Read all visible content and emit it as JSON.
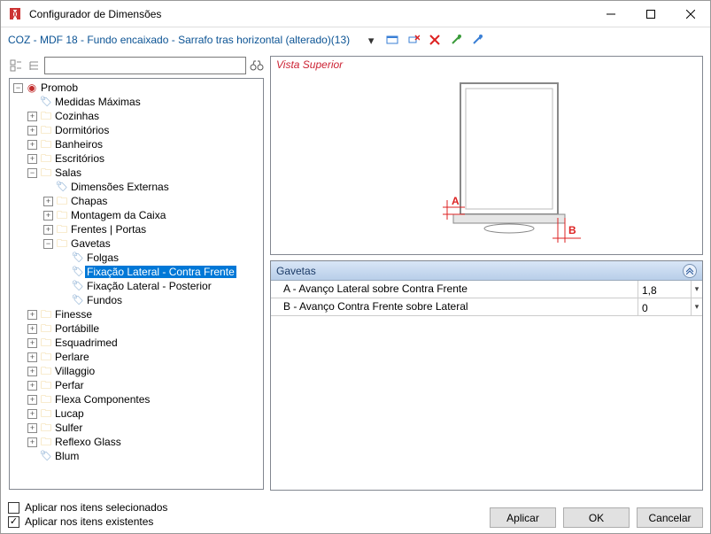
{
  "window": {
    "title": "Configurador de Dimensões"
  },
  "subtitle": "COZ - MDF 18 - Fundo encaixado - Sarrafo tras horizontal (alterado)(13)",
  "search": {
    "value": "",
    "placeholder": ""
  },
  "tree": {
    "root": "Promob",
    "n_medidas": "Medidas Máximas",
    "n_cozinhas": "Cozinhas",
    "n_dormitorios": "Dormitórios",
    "n_banheiros": "Banheiros",
    "n_escritorios": "Escritórios",
    "n_salas": "Salas",
    "n_dimext": "Dimensões Externas",
    "n_chapas": "Chapas",
    "n_montagem": "Montagem da Caixa",
    "n_frentes": "Frentes | Portas",
    "n_gavetas": "Gavetas",
    "n_folgas": "Folgas",
    "n_fixcf": "Fixação Lateral - Contra Frente",
    "n_fixpost": "Fixação Lateral - Posterior",
    "n_fundos": "Fundos",
    "n_finesse": "Finesse",
    "n_portabille": "Portábille",
    "n_esquadrimed": "Esquadrimed",
    "n_perlare": "Perlare",
    "n_villaggio": "Villaggio",
    "n_perfar": "Perfar",
    "n_flexa": "Flexa Componentes",
    "n_lucap": "Lucap",
    "n_sulfer": "Sulfer",
    "n_reflexo": "Reflexo Glass",
    "n_blum": "Blum"
  },
  "view": {
    "title": "Vista Superior",
    "label_a": "A",
    "label_b": "B"
  },
  "props": {
    "header": "Gavetas",
    "rows": [
      {
        "name": "A - Avanço Lateral sobre Contra Frente",
        "value": "1,8"
      },
      {
        "name": "B - Avanço Contra Frente sobre Lateral",
        "value": "0"
      }
    ]
  },
  "checks": {
    "chk_sel": "Aplicar nos itens selecionados",
    "chk_ex": "Aplicar nos itens existentes"
  },
  "buttons": {
    "apply": "Aplicar",
    "ok": "OK",
    "cancel": "Cancelar"
  }
}
